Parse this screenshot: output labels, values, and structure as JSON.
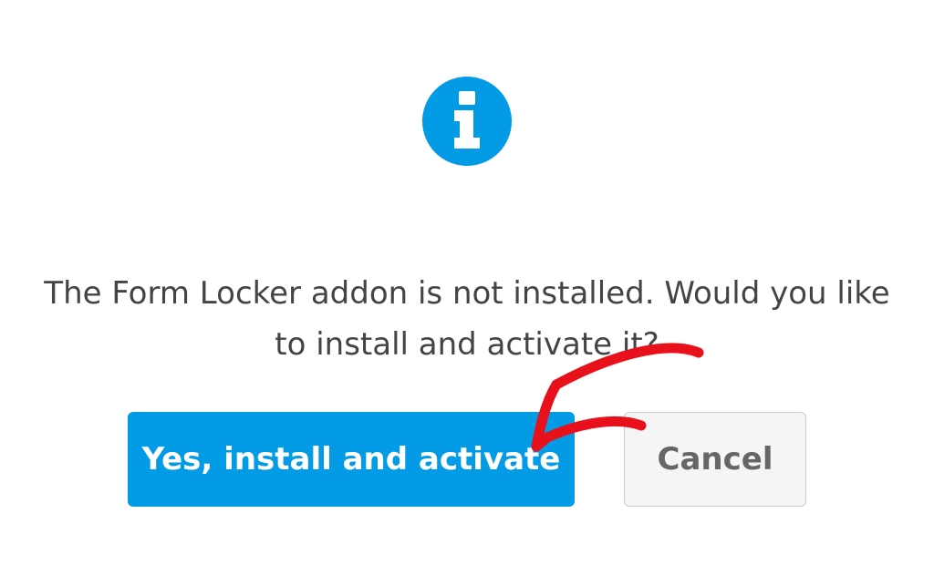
{
  "dialog": {
    "icon": "info-circle-icon",
    "message": "The Form Locker addon is not installed. Would you like to install and activate it?",
    "confirm_label": "Yes, install and activate",
    "cancel_label": "Cancel"
  },
  "colors": {
    "accent": "#039be5",
    "annotation": "#e8101b",
    "text": "#444444",
    "cancel_bg": "#f5f5f5"
  }
}
